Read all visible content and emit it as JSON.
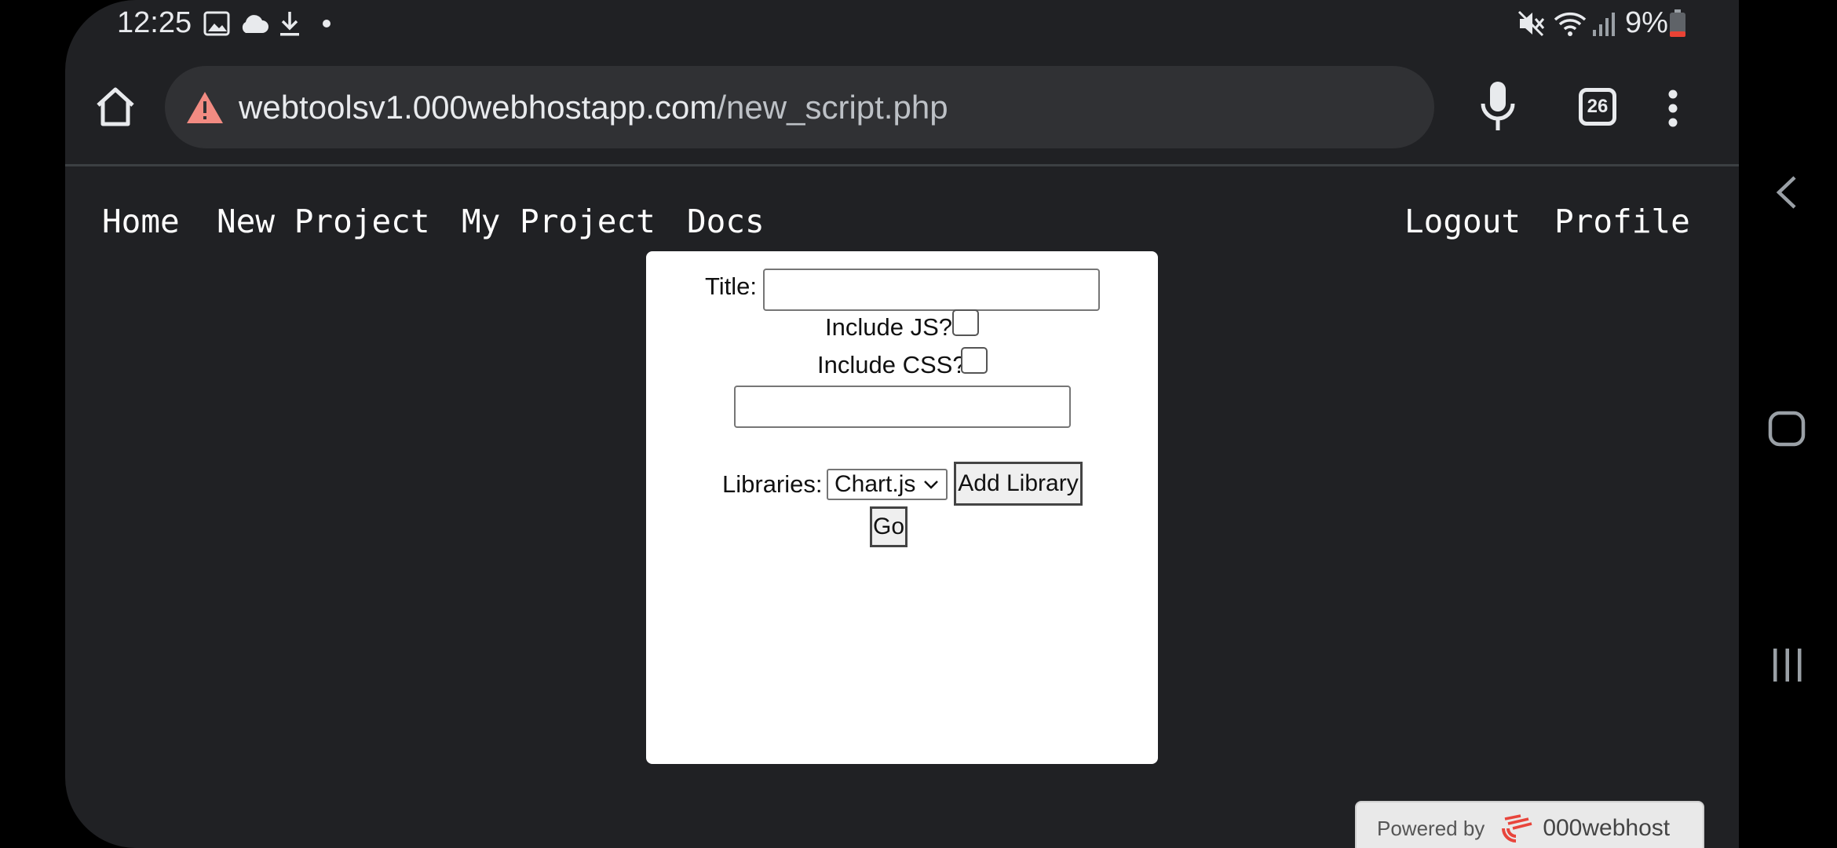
{
  "status_bar": {
    "time": "12:25",
    "battery": "9%",
    "icons_left": [
      "image-icon",
      "cloud-icon",
      "download-icon",
      "dot-icon"
    ],
    "icons_right": [
      "mute-icon",
      "wifi-icon",
      "signal-icon",
      "battery-icon"
    ]
  },
  "browser": {
    "url_host": "webtoolsv1.000webhostapp.com",
    "url_path": "/new_script.php",
    "tab_count": "26"
  },
  "nav": {
    "left": [
      "Home",
      "New Project",
      "My Project",
      "Docs"
    ],
    "right": [
      "Logout",
      "Profile"
    ]
  },
  "form": {
    "title_label": "Title:",
    "title_value": "",
    "include_js_label": "Include JS?",
    "include_js_checked": false,
    "include_css_label": "Include CSS?",
    "include_css_checked": false,
    "extra_input_value": "",
    "libraries_label": "Libraries:",
    "library_selected": "Chart.js",
    "add_library_label": "Add Library",
    "go_label": "Go"
  },
  "badge": {
    "prefix": "Powered by",
    "brand": "000webhost"
  },
  "colors": {
    "background": "#202124",
    "card": "#ffffff",
    "warning": "#f28b82"
  }
}
